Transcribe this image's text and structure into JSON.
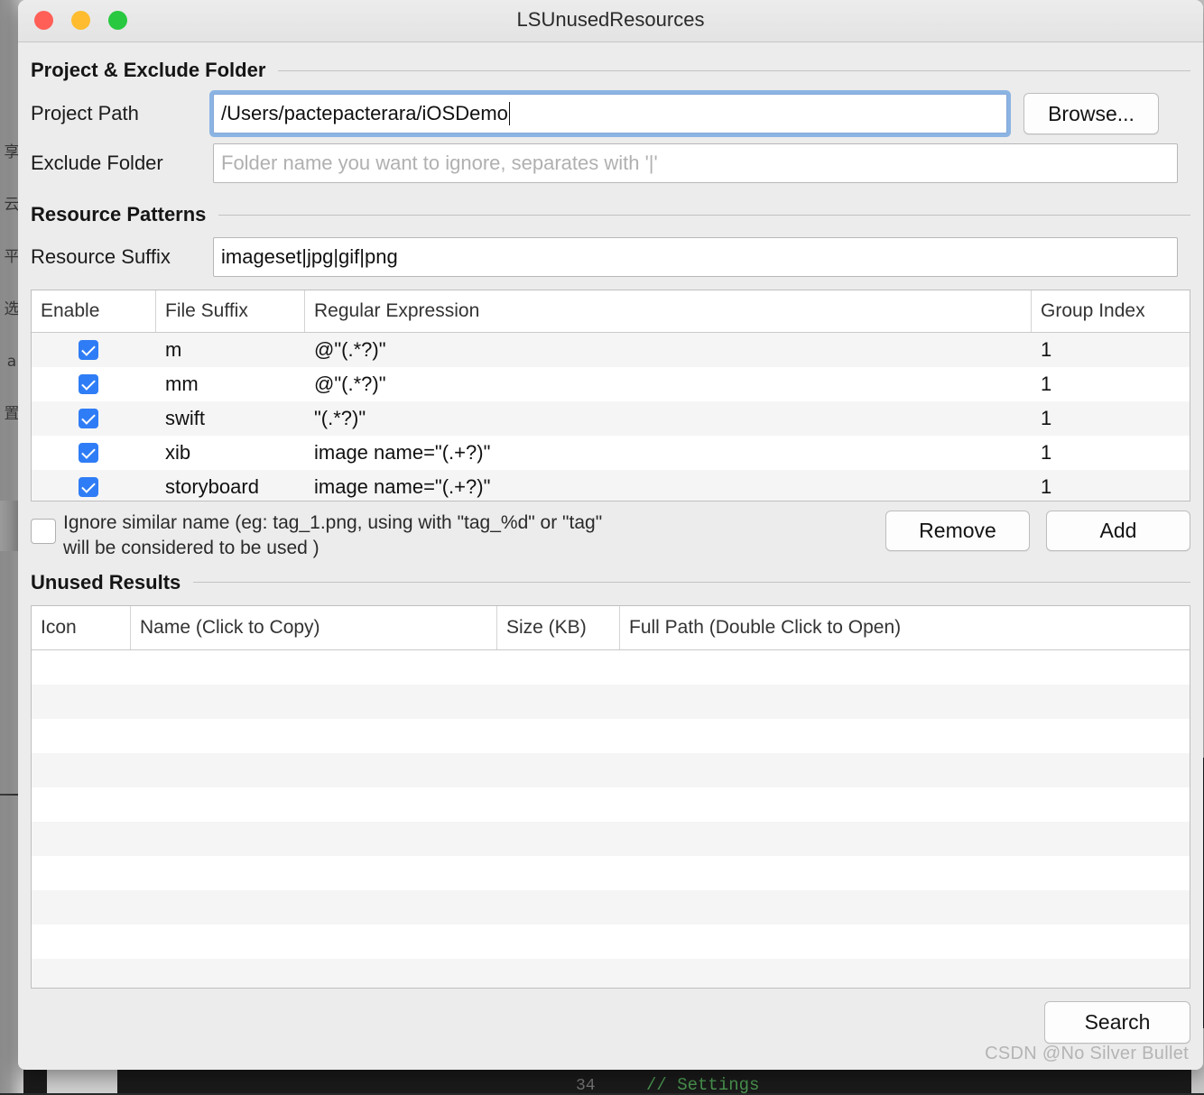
{
  "window": {
    "title": "LSUnusedResources",
    "traffic_lights": [
      {
        "name": "close",
        "color": "#ff5f57"
      },
      {
        "name": "minimize",
        "color": "#febc2e"
      },
      {
        "name": "maximize",
        "color": "#28c840"
      }
    ]
  },
  "project_group": {
    "heading": "Project & Exclude Folder",
    "project_path": {
      "label": "Project Path",
      "value": "/Users/pactepacterara/iOSDemo",
      "focused": true
    },
    "browse_button": "Browse...",
    "exclude_folder": {
      "label": "Exclude Folder",
      "value": "",
      "placeholder": "Folder name you want to ignore, separates with '|'"
    }
  },
  "patterns_group": {
    "heading": "Resource Patterns",
    "resource_suffix": {
      "label": "Resource Suffix",
      "value": "imageset|jpg|gif|png"
    },
    "table": {
      "columns": [
        "Enable",
        "File Suffix",
        "Regular Expression",
        "Group Index"
      ],
      "rows": [
        {
          "enable": true,
          "file_suffix": "m",
          "regex": "@\"(.*?)\"",
          "group_index": "1"
        },
        {
          "enable": true,
          "file_suffix": "mm",
          "regex": "@\"(.*?)\"",
          "group_index": "1"
        },
        {
          "enable": true,
          "file_suffix": "swift",
          "regex": "\"(.*?)\"",
          "group_index": "1"
        },
        {
          "enable": true,
          "file_suffix": "xib",
          "regex": "image name=\"(.+?)\"",
          "group_index": "1"
        },
        {
          "enable": true,
          "file_suffix": "storyboard",
          "regex": "image name=\"(.+?)\"",
          "group_index": "1"
        },
        {
          "enable": true,
          "file_suffix": "",
          "regex": "",
          "group_index": ""
        }
      ]
    },
    "ignore_similar": {
      "checked": false,
      "line1": "Ignore similar name (eg: tag_1.png, using with \"tag_%d\" or \"tag\"",
      "line2": "will be considered to be used )"
    },
    "remove_button": "Remove",
    "add_button": "Add"
  },
  "results_group": {
    "heading": "Unused Results",
    "table": {
      "columns": [
        "Icon",
        "Name (Click to Copy)",
        "Size (KB)",
        "Full Path (Double Click to Open)"
      ],
      "rows": []
    }
  },
  "footer": {
    "search_button": "Search"
  },
  "watermark": "CSDN @No Silver Bullet",
  "backdrop": {
    "left_glyphs": "享云平选a置",
    "code_line": "// Settings",
    "code_number": "34"
  }
}
